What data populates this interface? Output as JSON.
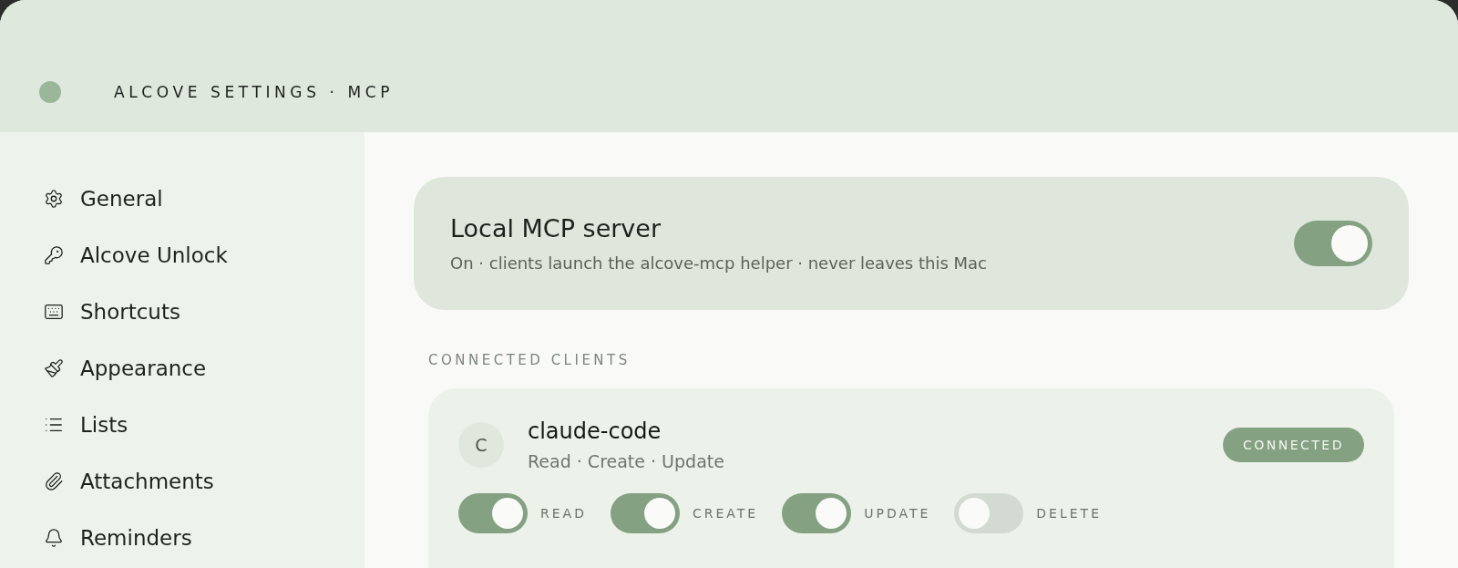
{
  "window": {
    "title": "ALCOVE SETTINGS · MCP"
  },
  "sidebar": {
    "items": [
      {
        "label": "General",
        "selected": false
      },
      {
        "label": "Alcove Unlock",
        "selected": false
      },
      {
        "label": "Shortcuts",
        "selected": false
      },
      {
        "label": "Appearance",
        "selected": false
      },
      {
        "label": "Lists",
        "selected": false
      },
      {
        "label": "Attachments",
        "selected": false
      },
      {
        "label": "Reminders",
        "selected": false
      }
    ]
  },
  "server": {
    "title": "Local MCP server",
    "subtitle": "On · clients launch the alcove-mcp helper · never leaves this Mac",
    "on": true
  },
  "clients_heading": "CONNECTED CLIENTS",
  "clients": [
    {
      "avatar": "C",
      "name": "claude-code",
      "summary": "Read · Create · Update",
      "status": "CONNECTED",
      "permissions": [
        {
          "label": "READ",
          "on": true
        },
        {
          "label": "CREATE",
          "on": true
        },
        {
          "label": "UPDATE",
          "on": true
        },
        {
          "label": "DELETE",
          "on": false
        }
      ]
    }
  ]
}
